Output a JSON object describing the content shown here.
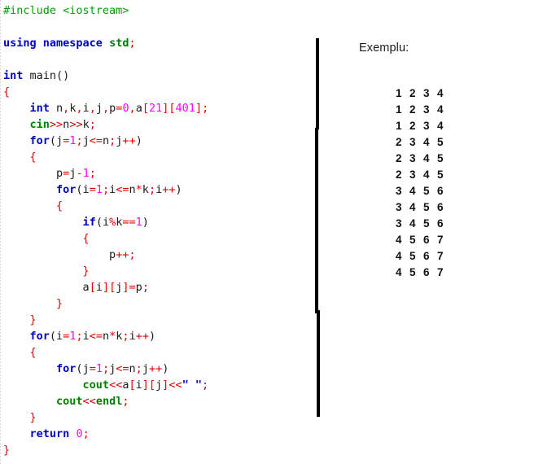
{
  "code": {
    "language": "C++",
    "lines": [
      {
        "indent": 0,
        "tokens": [
          {
            "t": "#include <iostream>",
            "c": "pre"
          }
        ]
      },
      {
        "indent": 0,
        "tokens": []
      },
      {
        "indent": 0,
        "tokens": [
          {
            "t": "using",
            "c": "kw"
          },
          {
            "t": " ",
            "c": "pln"
          },
          {
            "t": "namespace",
            "c": "kw"
          },
          {
            "t": " ",
            "c": "pln"
          },
          {
            "t": "std",
            "c": "lib"
          },
          {
            "t": ";",
            "c": "pun"
          }
        ]
      },
      {
        "indent": 0,
        "tokens": []
      },
      {
        "indent": 0,
        "tokens": [
          {
            "t": "int",
            "c": "kw"
          },
          {
            "t": " main()",
            "c": "pln"
          }
        ]
      },
      {
        "indent": 0,
        "tokens": [
          {
            "t": "{",
            "c": "pun"
          }
        ]
      },
      {
        "indent": 1,
        "tokens": [
          {
            "t": "int",
            "c": "kw"
          },
          {
            "t": " n",
            "c": "pln"
          },
          {
            "t": ",",
            "c": "pun"
          },
          {
            "t": "k",
            "c": "pln"
          },
          {
            "t": ",",
            "c": "pun"
          },
          {
            "t": "i",
            "c": "pln"
          },
          {
            "t": ",",
            "c": "pun"
          },
          {
            "t": "j",
            "c": "pln"
          },
          {
            "t": ",",
            "c": "pun"
          },
          {
            "t": "p",
            "c": "pln"
          },
          {
            "t": "=",
            "c": "pun"
          },
          {
            "t": "0",
            "c": "num"
          },
          {
            "t": ",",
            "c": "pun"
          },
          {
            "t": "a",
            "c": "pln"
          },
          {
            "t": "[",
            "c": "pun"
          },
          {
            "t": "21",
            "c": "num"
          },
          {
            "t": "]",
            "c": "pun"
          },
          {
            "t": "[",
            "c": "pun"
          },
          {
            "t": "401",
            "c": "num"
          },
          {
            "t": "]",
            "c": "pun"
          },
          {
            "t": ";",
            "c": "pun"
          }
        ]
      },
      {
        "indent": 1,
        "tokens": [
          {
            "t": "cin",
            "c": "lib"
          },
          {
            "t": ">>",
            "c": "pun"
          },
          {
            "t": "n",
            "c": "pln"
          },
          {
            "t": ">>",
            "c": "pun"
          },
          {
            "t": "k",
            "c": "pln"
          },
          {
            "t": ";",
            "c": "pun"
          }
        ]
      },
      {
        "indent": 1,
        "tokens": [
          {
            "t": "for",
            "c": "kw"
          },
          {
            "t": "(j",
            "c": "pln"
          },
          {
            "t": "=",
            "c": "pun"
          },
          {
            "t": "1",
            "c": "num"
          },
          {
            "t": ";",
            "c": "pun"
          },
          {
            "t": "j",
            "c": "pln"
          },
          {
            "t": "<=",
            "c": "pun"
          },
          {
            "t": "n",
            "c": "pln"
          },
          {
            "t": ";",
            "c": "pun"
          },
          {
            "t": "j",
            "c": "pln"
          },
          {
            "t": "++",
            "c": "pun"
          },
          {
            "t": ")",
            "c": "pln"
          }
        ]
      },
      {
        "indent": 1,
        "tokens": [
          {
            "t": "{",
            "c": "pun"
          }
        ]
      },
      {
        "indent": 2,
        "tokens": [
          {
            "t": "p",
            "c": "pln"
          },
          {
            "t": "=",
            "c": "pun"
          },
          {
            "t": "j",
            "c": "pln"
          },
          {
            "t": "-",
            "c": "pun"
          },
          {
            "t": "1",
            "c": "num"
          },
          {
            "t": ";",
            "c": "pun"
          }
        ]
      },
      {
        "indent": 2,
        "tokens": [
          {
            "t": "for",
            "c": "kw"
          },
          {
            "t": "(i",
            "c": "pln"
          },
          {
            "t": "=",
            "c": "pun"
          },
          {
            "t": "1",
            "c": "num"
          },
          {
            "t": ";",
            "c": "pun"
          },
          {
            "t": "i",
            "c": "pln"
          },
          {
            "t": "<=",
            "c": "pun"
          },
          {
            "t": "n",
            "c": "pln"
          },
          {
            "t": "*",
            "c": "pun"
          },
          {
            "t": "k",
            "c": "pln"
          },
          {
            "t": ";",
            "c": "pun"
          },
          {
            "t": "i",
            "c": "pln"
          },
          {
            "t": "++",
            "c": "pun"
          },
          {
            "t": ")",
            "c": "pln"
          }
        ]
      },
      {
        "indent": 2,
        "tokens": [
          {
            "t": "{",
            "c": "pun"
          }
        ]
      },
      {
        "indent": 3,
        "tokens": [
          {
            "t": "if",
            "c": "kw"
          },
          {
            "t": "(i",
            "c": "pln"
          },
          {
            "t": "%",
            "c": "pun"
          },
          {
            "t": "k",
            "c": "pln"
          },
          {
            "t": "==",
            "c": "pun"
          },
          {
            "t": "1",
            "c": "num"
          },
          {
            "t": ")",
            "c": "pln"
          }
        ]
      },
      {
        "indent": 3,
        "tokens": [
          {
            "t": "{",
            "c": "pun"
          }
        ]
      },
      {
        "indent": 4,
        "tokens": [
          {
            "t": "p",
            "c": "pln"
          },
          {
            "t": "++",
            "c": "pun"
          },
          {
            "t": ";",
            "c": "pun"
          }
        ]
      },
      {
        "indent": 3,
        "tokens": [
          {
            "t": "}",
            "c": "pun"
          }
        ]
      },
      {
        "indent": 3,
        "tokens": [
          {
            "t": "a",
            "c": "pln"
          },
          {
            "t": "[",
            "c": "pun"
          },
          {
            "t": "i",
            "c": "pln"
          },
          {
            "t": "]",
            "c": "pun"
          },
          {
            "t": "[",
            "c": "pun"
          },
          {
            "t": "j",
            "c": "pln"
          },
          {
            "t": "]",
            "c": "pun"
          },
          {
            "t": "=",
            "c": "pun"
          },
          {
            "t": "p",
            "c": "pln"
          },
          {
            "t": ";",
            "c": "pun"
          }
        ]
      },
      {
        "indent": 2,
        "tokens": [
          {
            "t": "}",
            "c": "pun"
          }
        ]
      },
      {
        "indent": 1,
        "tokens": [
          {
            "t": "}",
            "c": "pun"
          }
        ]
      },
      {
        "indent": 1,
        "tokens": [
          {
            "t": "for",
            "c": "kw"
          },
          {
            "t": "(i",
            "c": "pln"
          },
          {
            "t": "=",
            "c": "pun"
          },
          {
            "t": "1",
            "c": "num"
          },
          {
            "t": ";",
            "c": "pun"
          },
          {
            "t": "i",
            "c": "pln"
          },
          {
            "t": "<=",
            "c": "pun"
          },
          {
            "t": "n",
            "c": "pln"
          },
          {
            "t": "*",
            "c": "pun"
          },
          {
            "t": "k",
            "c": "pln"
          },
          {
            "t": ";",
            "c": "pun"
          },
          {
            "t": "i",
            "c": "pln"
          },
          {
            "t": "++",
            "c": "pun"
          },
          {
            "t": ")",
            "c": "pln"
          }
        ]
      },
      {
        "indent": 1,
        "tokens": [
          {
            "t": "{",
            "c": "pun"
          }
        ]
      },
      {
        "indent": 2,
        "tokens": [
          {
            "t": "for",
            "c": "kw"
          },
          {
            "t": "(j",
            "c": "pln"
          },
          {
            "t": "=",
            "c": "pun"
          },
          {
            "t": "1",
            "c": "num"
          },
          {
            "t": ";",
            "c": "pun"
          },
          {
            "t": "j",
            "c": "pln"
          },
          {
            "t": "<=",
            "c": "pun"
          },
          {
            "t": "n",
            "c": "pln"
          },
          {
            "t": ";",
            "c": "pun"
          },
          {
            "t": "j",
            "c": "pln"
          },
          {
            "t": "++",
            "c": "pun"
          },
          {
            "t": ")",
            "c": "pln"
          }
        ]
      },
      {
        "indent": 3,
        "tokens": [
          {
            "t": "cout",
            "c": "lib"
          },
          {
            "t": "<<",
            "c": "pun"
          },
          {
            "t": "a",
            "c": "pln"
          },
          {
            "t": "[",
            "c": "pun"
          },
          {
            "t": "i",
            "c": "pln"
          },
          {
            "t": "]",
            "c": "pun"
          },
          {
            "t": "[",
            "c": "pun"
          },
          {
            "t": "j",
            "c": "pln"
          },
          {
            "t": "]",
            "c": "pun"
          },
          {
            "t": "<<",
            "c": "pun"
          },
          {
            "t": "\" \"",
            "c": "str"
          },
          {
            "t": ";",
            "c": "pun"
          }
        ]
      },
      {
        "indent": 2,
        "tokens": [
          {
            "t": "cout",
            "c": "lib"
          },
          {
            "t": "<<",
            "c": "pun"
          },
          {
            "t": "endl",
            "c": "lib"
          },
          {
            "t": ";",
            "c": "pun"
          }
        ]
      },
      {
        "indent": 1,
        "tokens": [
          {
            "t": "}",
            "c": "pun"
          }
        ]
      },
      {
        "indent": 1,
        "tokens": [
          {
            "t": "return",
            "c": "kw"
          },
          {
            "t": " ",
            "c": "pln"
          },
          {
            "t": "0",
            "c": "num"
          },
          {
            "t": ";",
            "c": "pun"
          }
        ]
      },
      {
        "indent": 0,
        "tokens": [
          {
            "t": "}",
            "c": "pun"
          }
        ]
      }
    ]
  },
  "example": {
    "title": "Exemplu:",
    "output_rows": [
      [
        "1",
        "2",
        "3",
        "4"
      ],
      [
        "1",
        "2",
        "3",
        "4"
      ],
      [
        "1",
        "2",
        "3",
        "4"
      ],
      [
        "2",
        "3",
        "4",
        "5"
      ],
      [
        "2",
        "3",
        "4",
        "5"
      ],
      [
        "2",
        "3",
        "4",
        "5"
      ],
      [
        "3",
        "4",
        "5",
        "6"
      ],
      [
        "3",
        "4",
        "5",
        "6"
      ],
      [
        "3",
        "4",
        "5",
        "6"
      ],
      [
        "4",
        "5",
        "6",
        "7"
      ],
      [
        "4",
        "5",
        "6",
        "7"
      ],
      [
        "4",
        "5",
        "6",
        "7"
      ]
    ]
  },
  "colors": {
    "keyword": "#0000c0",
    "library": "#008000",
    "preprocessor": "#00a000",
    "number": "#ff00ff",
    "punctuation": "#e00000",
    "string": "#0000c0",
    "plain": "#1a1a1a",
    "divider": "#000000",
    "background": "#ffffff"
  }
}
